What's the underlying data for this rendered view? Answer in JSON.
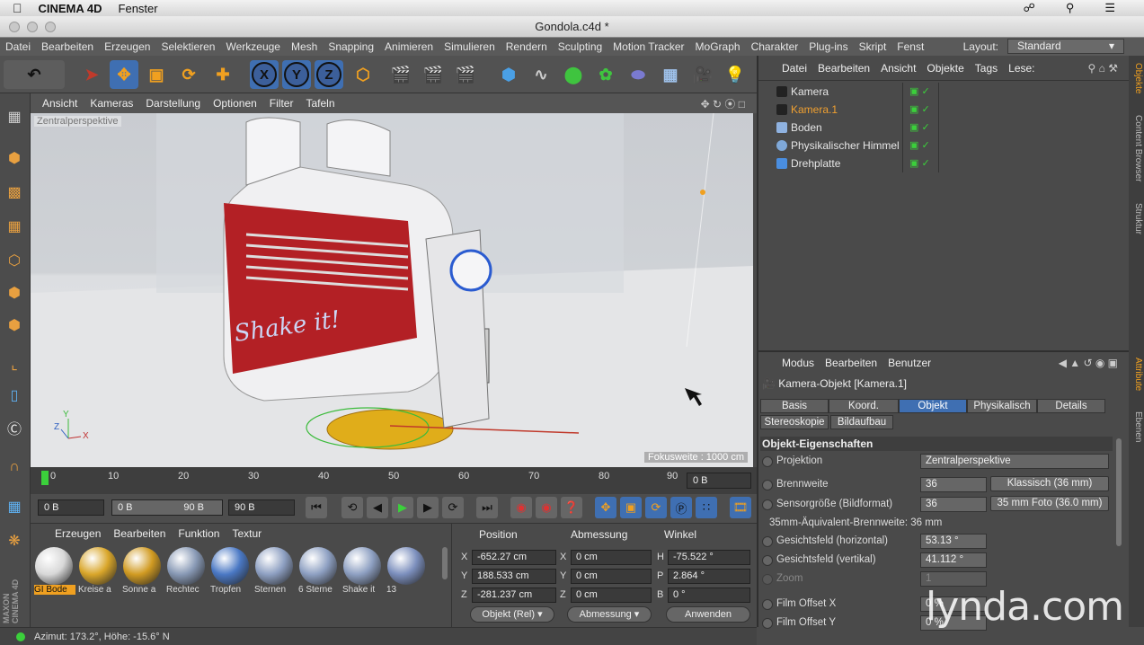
{
  "macbar": {
    "app_name": "CINEMA 4D",
    "menu": "Fenster"
  },
  "window": {
    "title": "Gondola.c4d *"
  },
  "menu": [
    "Datei",
    "Bearbeiten",
    "Erzeugen",
    "Selektieren",
    "Werkzeuge",
    "Mesh",
    "Snapping",
    "Animieren",
    "Simulieren",
    "Rendern",
    "Sculpting",
    "Motion Tracker",
    "MoGraph",
    "Charakter",
    "Plug-ins",
    "Skript",
    "Fenst"
  ],
  "layout": {
    "label": "Layout:",
    "value": "Standard"
  },
  "viewport": {
    "menu": [
      "Ansicht",
      "Kameras",
      "Darstellung",
      "Optionen",
      "Filter",
      "Tafeln"
    ],
    "projection_label": "Zentralperspektive",
    "focal_label": "Fokusweite : 1000 cm",
    "text_on_model": "Shake it!",
    "axis_labels": {
      "y": "Y",
      "z": "Z",
      "x": "X"
    }
  },
  "timeline": {
    "ticks": [
      "0",
      "10",
      "20",
      "30",
      "40",
      "50",
      "60",
      "70",
      "80",
      "90"
    ],
    "current_frame": "0 B"
  },
  "transport": {
    "start_field": "0 B",
    "min_field": "0 B",
    "max_field": "90 B",
    "end_field": "90 B"
  },
  "materials": {
    "menu": [
      "Erzeugen",
      "Bearbeiten",
      "Funktion",
      "Textur"
    ],
    "items": [
      {
        "name": "GI Bode",
        "color": "#d8d8d8"
      },
      {
        "name": "Kreise a",
        "color": "#d9a62a"
      },
      {
        "name": "Sonne a",
        "color": "#d19b22"
      },
      {
        "name": "Rechtec",
        "color": "#8899b5"
      },
      {
        "name": "Tropfen",
        "color": "#4a78c4"
      },
      {
        "name": "Sternen",
        "color": "#8ea0c2"
      },
      {
        "name": "6 Sterne",
        "color": "#8ea0c2"
      },
      {
        "name": "Shake it",
        "color": "#8ea0c2"
      },
      {
        "name": "13",
        "color": "#7c8fbd"
      }
    ]
  },
  "coordinates": {
    "headers": [
      "Position",
      "Abmessung",
      "Winkel"
    ],
    "rows": [
      {
        "axis": "X",
        "pos": "-652.27 cm",
        "size_axis": "X",
        "size": "0 cm",
        "rot_axis": "H",
        "rot": "-75.522 °"
      },
      {
        "axis": "Y",
        "pos": "188.533 cm",
        "size_axis": "Y",
        "size": "0 cm",
        "rot_axis": "P",
        "rot": "2.864 °"
      },
      {
        "axis": "Z",
        "pos": "-281.237 cm",
        "size_axis": "Z",
        "size": "0 cm",
        "rot_axis": "B",
        "rot": "0 °"
      }
    ],
    "mode_dropdown": "Objekt (Rel)",
    "size_dropdown": "Abmessung",
    "apply_button": "Anwenden"
  },
  "status": "Azimut: 173.2°, Höhe: -15.6°  N",
  "objects": {
    "menu": [
      "Datei",
      "Bearbeiten",
      "Ansicht",
      "Objekte",
      "Tags",
      "Lese:"
    ],
    "items": [
      {
        "name": "Kamera",
        "color": "#e6e6e6"
      },
      {
        "name": "Kamera.1",
        "color": "#f0a030"
      },
      {
        "name": "Boden",
        "color": "#e6e6e6"
      },
      {
        "name": "Physikalischer Himmel",
        "color": "#e6e6e6"
      },
      {
        "name": "Drehplatte",
        "color": "#e6e6e6"
      }
    ]
  },
  "right_tabs": [
    "Objekte",
    "Content Browser",
    "Struktur",
    "Attribute",
    "Ebenen"
  ],
  "attributes": {
    "menu": [
      "Modus",
      "Bearbeiten",
      "Benutzer"
    ],
    "object_title": "Kamera-Objekt [Kamera.1]",
    "tabs_row1": [
      "Basis",
      "Koord.",
      "Objekt",
      "Physikalisch",
      "Details"
    ],
    "tabs_row2": [
      "Stereoskopie",
      "Bildaufbau"
    ],
    "active_tab": "Objekt",
    "section": "Objekt-Eigenschaften",
    "projection_label": "Projektion",
    "projection_value": "Zentralperspektive",
    "focal_label": "Brennweite",
    "focal_value": "36",
    "focal_preset": "Klassisch (36 mm)",
    "sensor_label": "Sensorgröße (Bildformat)",
    "sensor_value": "36",
    "sensor_preset": "35 mm Foto (36.0 mm)",
    "equiv_text": "35mm-Äquivalent-Brennweite: 36 mm",
    "fov_h_label": "Gesichtsfeld (horizontal)",
    "fov_h_value": "53.13 °",
    "fov_v_label": "Gesichtsfeld (vertikal)",
    "fov_v_value": "41.112 °",
    "zoom_label": "Zoom",
    "zoom_value": "1",
    "film_x_label": "Film Offset X",
    "film_x_value": "0 %",
    "film_y_label": "Film Offset Y",
    "film_y_value": "0 %"
  },
  "watermark": "lynda.com",
  "brand_vertical": "MAXON CINEMA 4D"
}
